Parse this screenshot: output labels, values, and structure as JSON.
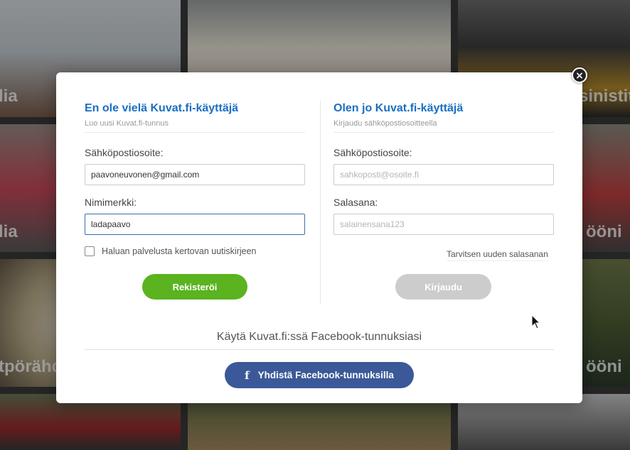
{
  "background": {
    "captions": [
      "lia",
      "sinistit",
      "lia",
      "ööni",
      "tpörähdy",
      "ööni"
    ]
  },
  "modal": {
    "close_symbol": "×",
    "register": {
      "title": "En ole vielä Kuvat.fi-käyttäjä",
      "subtitle": "Luo uusi Kuvat.fi-tunnus",
      "email_label": "Sähköpostiosoite:",
      "email_value": "paavoneuvonen@gmail.com",
      "nick_label": "Nimimerkki:",
      "nick_value": "ladapaavo",
      "newsletter_label": "Haluan palvelusta kertovan uutiskirjeen",
      "newsletter_checked": false,
      "submit_label": "Rekisteröi"
    },
    "login": {
      "title": "Olen jo Kuvat.fi-käyttäjä",
      "subtitle": "Kirjaudu sähköpostiosoitteella",
      "email_label": "Sähköpostiosoite:",
      "email_placeholder": "sahkoposti@osoite.fi",
      "password_label": "Salasana:",
      "password_placeholder": "salainensana123",
      "forgot_label": "Tarvitsen uuden salasanan",
      "submit_label": "Kirjaudu"
    },
    "facebook": {
      "heading": "Käytä Kuvat.fi:ssä Facebook-tunnuksiasi",
      "icon": "f",
      "button_label": "Yhdistä Facebook-tunnuksilla"
    }
  },
  "colors": {
    "title_blue": "#1a6fc4",
    "register_green": "#5ab31f",
    "login_gray": "#cccccc",
    "facebook_blue": "#3b5998"
  }
}
